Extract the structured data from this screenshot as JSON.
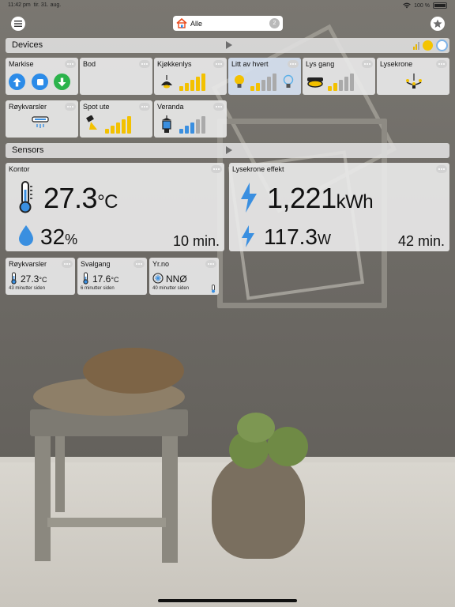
{
  "status_bar": {
    "time": "11:42 pm",
    "date": "tir. 31. aug.",
    "battery": "100 %"
  },
  "header": {
    "location": "Alle",
    "count": "2"
  },
  "devices_section": {
    "title": "Devices"
  },
  "sensors_section": {
    "title": "Sensors"
  },
  "colors": {
    "accent_yellow": "#f3c100",
    "accent_blue": "#3a8fe0",
    "accent_green": "#2bb34b"
  },
  "devices": [
    {
      "name": "Markise",
      "kind": "shutter"
    },
    {
      "name": "Bod",
      "kind": "empty"
    },
    {
      "name": "Kjøkkenlys",
      "kind": "lamp",
      "level": 4
    },
    {
      "name": "Litt av hvert",
      "kind": "multi",
      "level": 2
    },
    {
      "name": "Lys gang",
      "kind": "ceiling",
      "level": 2
    },
    {
      "name": "Lysekrone",
      "kind": "chandelier"
    },
    {
      "name": "Røykvarsler",
      "kind": "smoke"
    },
    {
      "name": "Spot ute",
      "kind": "spot",
      "level": 4
    },
    {
      "name": "Veranda",
      "kind": "lantern",
      "level": 2
    }
  ],
  "sensors": {
    "kontor": {
      "name": "Kontor",
      "temp": "27.3",
      "temp_unit": "°C",
      "humidity": "32",
      "humidity_unit": "%",
      "age": "10 min."
    },
    "lysekrone": {
      "name": "Lysekrone effekt",
      "energy": "1,221",
      "energy_unit": "kWh",
      "power": "117.3",
      "power_unit": "W",
      "age": "42 min."
    },
    "small": [
      {
        "name": "Røykvarsler",
        "value": "27.3",
        "unit": "°C",
        "age": "43 minutter siden"
      },
      {
        "name": "Svalgang",
        "value": "17.6",
        "unit": "°C",
        "age": "6 minutter siden"
      },
      {
        "name": "Yr.no",
        "value": "NNØ",
        "unit": "",
        "age": "40 minutter siden"
      }
    ]
  }
}
